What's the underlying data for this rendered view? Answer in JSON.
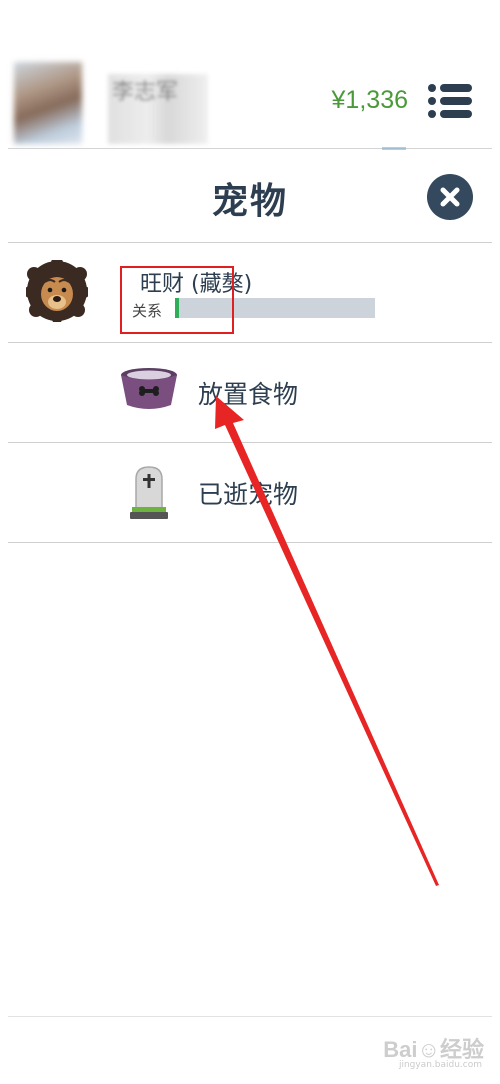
{
  "topbar": {
    "user_name": "李志军",
    "balance": "¥1,336",
    "menu_icon": "list-menu-icon"
  },
  "header": {
    "title": "宠物",
    "close_icon": "close-icon"
  },
  "pet": {
    "name": "旺财 (藏獒)",
    "avatar_icon": "lion-dog-icon",
    "relationship_label": "关系",
    "relationship_level": 0.02,
    "relationship_bar_color": "#2fae5a"
  },
  "actions": [
    {
      "label": "放置食物",
      "icon": "food-bowl-icon"
    },
    {
      "label": "已逝宠物",
      "icon": "tombstone-icon"
    }
  ],
  "watermark": {
    "text": "Bai☺经验",
    "sub": "jingyan.baidu.com"
  },
  "colors": {
    "accent_text": "#2c3e50",
    "balance": "#4a9a3a",
    "annotation": "#e02020"
  }
}
